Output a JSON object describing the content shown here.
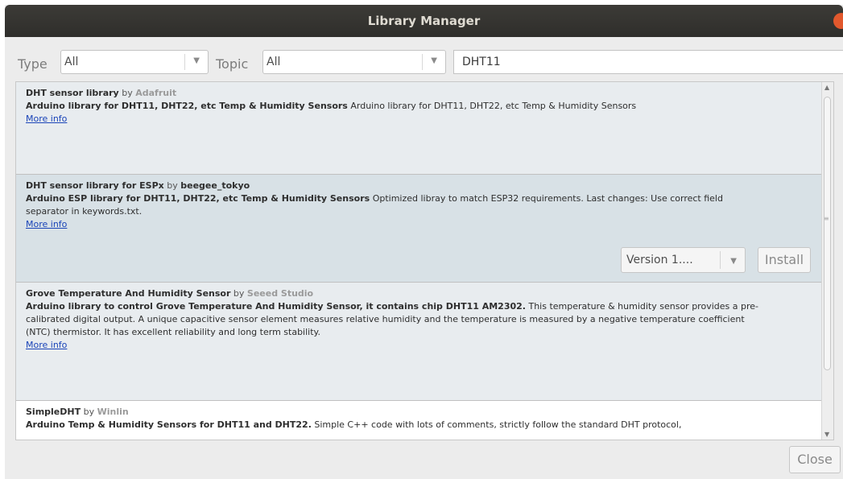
{
  "window": {
    "title": "Library Manager"
  },
  "filters": {
    "type_label": "Type",
    "type_value": "All",
    "topic_label": "Topic",
    "topic_value": "All",
    "search_value": "DHT11"
  },
  "libraries": [
    {
      "name": "DHT sensor library",
      "by": "by",
      "author": "Adafruit",
      "sentence": "Arduino library for DHT11, DHT22, etc Temp & Humidity Sensors",
      "paragraph": "Arduino library for DHT11, DHT22, etc Temp & Humidity Sensors",
      "more_info": "More info"
    },
    {
      "name": "DHT sensor library for ESPx",
      "by": "by",
      "author": "beegee_tokyo",
      "sentence": "Arduino ESP library for DHT11, DHT22, etc Temp & Humidity Sensors",
      "paragraph": "Optimized libray to match ESP32 requirements. Last changes: Use correct field separator in keywords.txt.",
      "more_info": "More info",
      "version_select": "Version 1....",
      "install_label": "Install"
    },
    {
      "name": "Grove Temperature And Humidity Sensor",
      "by": "by",
      "author": "Seeed Studio",
      "sentence": "Arduino library to control Grove Temperature And Humidity Sensor, it contains chip DHT11 AM2302.",
      "paragraph": "This temperature & humidity sensor provides a pre-calibrated digital output. A unique capacitive sensor element measures relative humidity and the temperature is measured by a negative temperature coefficient (NTC) thermistor. It has excellent reliability and long term stability.",
      "more_info": "More info"
    },
    {
      "name": "SimpleDHT",
      "by": "by",
      "author": "Winlin",
      "sentence": "Arduino Temp & Humidity Sensors for DHT11 and DHT22.",
      "paragraph": "Simple C++ code with lots of comments, strictly follow the standard DHT protocol,"
    }
  ],
  "footer": {
    "close_label": "Close"
  }
}
